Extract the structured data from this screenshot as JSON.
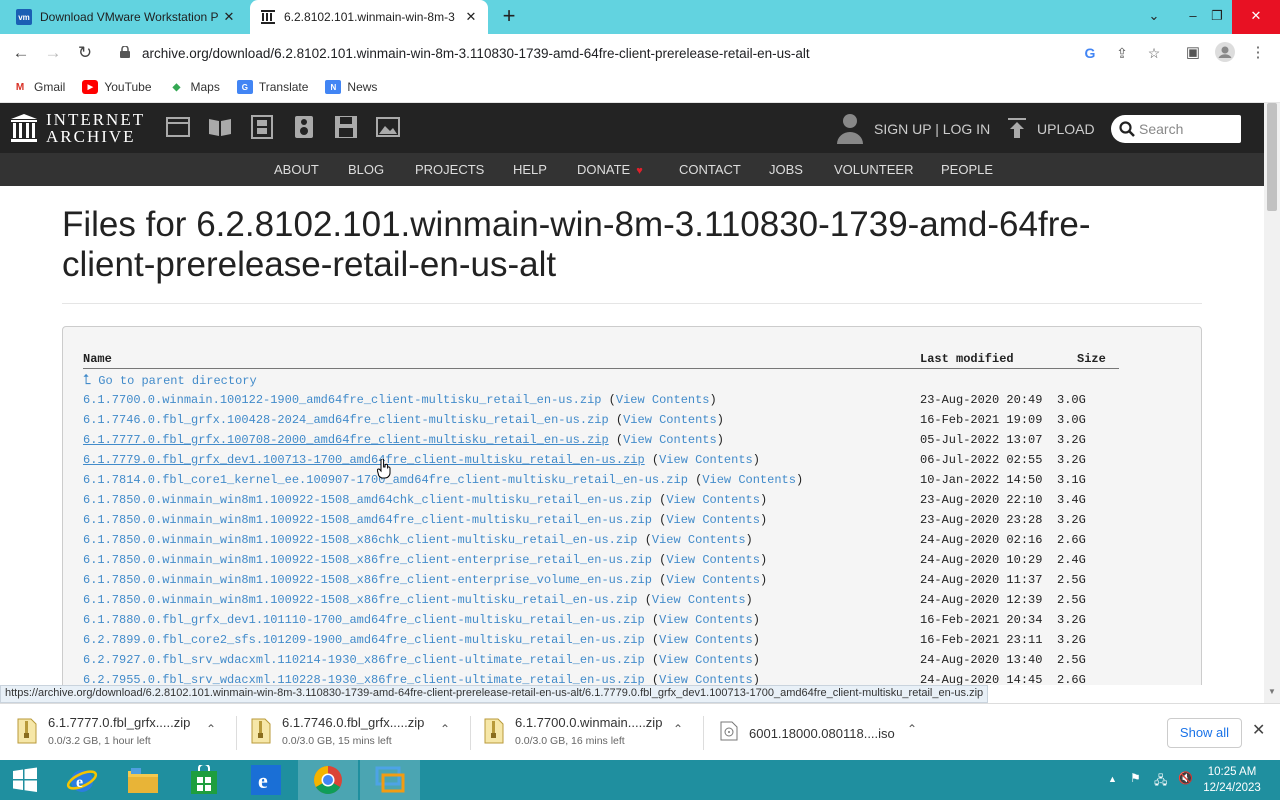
{
  "browser": {
    "tabs": [
      {
        "title": "Download VMware Workstation P",
        "favicon": "vmware-icon"
      },
      {
        "title": "6.2.8102.101.winmain-win-8m-3",
        "favicon": "internet-archive-icon"
      }
    ],
    "url": "archive.org/download/6.2.8102.101.winmain-win-8m-3.110830-1739-amd-64fre-client-prerelease-retail-en-us-alt",
    "bookmarks": [
      "Gmail",
      "YouTube",
      "Maps",
      "Translate",
      "News"
    ]
  },
  "ia": {
    "logo_line1": "INTERNET",
    "logo_line2": "ARCHIVE",
    "signup": "SIGN UP | LOG IN",
    "upload": "UPLOAD",
    "search_placeholder": "Search",
    "nav": [
      "ABOUT",
      "BLOG",
      "PROJECTS",
      "HELP",
      "DONATE",
      "CONTACT",
      "JOBS",
      "VOLUNTEER",
      "PEOPLE"
    ]
  },
  "page_title": "Files for 6.2.8102.101.winmain-win-8m-3.110830-1739-amd-64fre-client-prerelease-retail-en-us-alt",
  "listing": {
    "headers": {
      "name": "Name",
      "modified": "Last modified",
      "size": "Size"
    },
    "parent": "Go to parent directory",
    "view_contents": "View Contents",
    "rows": [
      {
        "name": "6.1.7700.0.winmain.100122-1900_amd64fre_client-multisku_retail_en-us.zip",
        "date": "23-Aug-2020 20:49",
        "size": "3.0G",
        "visited": false
      },
      {
        "name": "6.1.7746.0.fbl_grfx.100428-2024_amd64fre_client-multisku_retail_en-us.zip",
        "date": "16-Feb-2021 19:09",
        "size": "3.0G",
        "visited": false
      },
      {
        "name": "6.1.7777.0.fbl_grfx.100708-2000_amd64fre_client-multisku_retail_en-us.zip",
        "date": "05-Jul-2022 13:07",
        "size": "3.2G",
        "visited": true
      },
      {
        "name": "6.1.7779.0.fbl_grfx_dev1.100713-1700_amd64fre_client-multisku_retail_en-us.zip",
        "date": "06-Jul-2022 02:55",
        "size": "3.2G",
        "visited": true
      },
      {
        "name": "6.1.7814.0.fbl_core1_kernel_ee.100907-1700_amd64fre_client-multisku_retail_en-us.zip",
        "date": "10-Jan-2022 14:50",
        "size": "3.1G",
        "visited": false
      },
      {
        "name": "6.1.7850.0.winmain_win8m1.100922-1508_amd64chk_client-multisku_retail_en-us.zip",
        "date": "23-Aug-2020 22:10",
        "size": "3.4G",
        "visited": false
      },
      {
        "name": "6.1.7850.0.winmain_win8m1.100922-1508_amd64fre_client-multisku_retail_en-us.zip",
        "date": "23-Aug-2020 23:28",
        "size": "3.2G",
        "visited": false
      },
      {
        "name": "6.1.7850.0.winmain_win8m1.100922-1508_x86chk_client-multisku_retail_en-us.zip",
        "date": "24-Aug-2020 02:16",
        "size": "2.6G",
        "visited": false
      },
      {
        "name": "6.1.7850.0.winmain_win8m1.100922-1508_x86fre_client-enterprise_retail_en-us.zip",
        "date": "24-Aug-2020 10:29",
        "size": "2.4G",
        "visited": false
      },
      {
        "name": "6.1.7850.0.winmain_win8m1.100922-1508_x86fre_client-enterprise_volume_en-us.zip",
        "date": "24-Aug-2020 11:37",
        "size": "2.5G",
        "visited": false
      },
      {
        "name": "6.1.7850.0.winmain_win8m1.100922-1508_x86fre_client-multisku_retail_en-us.zip",
        "date": "24-Aug-2020 12:39",
        "size": "2.5G",
        "visited": false
      },
      {
        "name": "6.1.7880.0.fbl_grfx_dev1.101110-1700_amd64fre_client-multisku_retail_en-us.zip",
        "date": "16-Feb-2021 20:34",
        "size": "3.2G",
        "visited": false
      },
      {
        "name": "6.2.7899.0.fbl_core2_sfs.101209-1900_amd64fre_client-multisku_retail_en-us.zip",
        "date": "16-Feb-2021 23:11",
        "size": "3.2G",
        "visited": false
      },
      {
        "name": "6.2.7927.0.fbl_srv_wdacxml.110214-1930_x86fre_client-ultimate_retail_en-us.zip",
        "date": "24-Aug-2020 13:40",
        "size": "2.5G",
        "visited": false
      },
      {
        "name": "6.2.7955.0.fbl_srv_wdacxml.110228-1930_x86fre_client-ultimate_retail_en-us.zip",
        "date": "24-Aug-2020 14:45",
        "size": "2.6G",
        "visited": false
      }
    ]
  },
  "status_url": "https://archive.org/download/6.2.8102.101.winmain-win-8m-3.110830-1739-amd-64fre-client-prerelease-retail-en-us-alt/6.1.7779.0.fbl_grfx_dev1.100713-1700_amd64fre_client-multisku_retail_en-us.zip",
  "downloads": {
    "items": [
      {
        "name": "6.1.7777.0.fbl_grfx.....zip",
        "status": "0.0/3.2 GB, 1 hour left"
      },
      {
        "name": "6.1.7746.0.fbl_grfx.....zip",
        "status": "0.0/3.0 GB, 15 mins left"
      },
      {
        "name": "6.1.7700.0.winmain.....zip",
        "status": "0.0/3.0 GB, 16 mins left"
      },
      {
        "name": "6001.18000.080118....iso",
        "status": ""
      }
    ],
    "show_all": "Show all"
  },
  "taskbar": {
    "time": "10:25 AM",
    "date": "12/24/2023"
  }
}
